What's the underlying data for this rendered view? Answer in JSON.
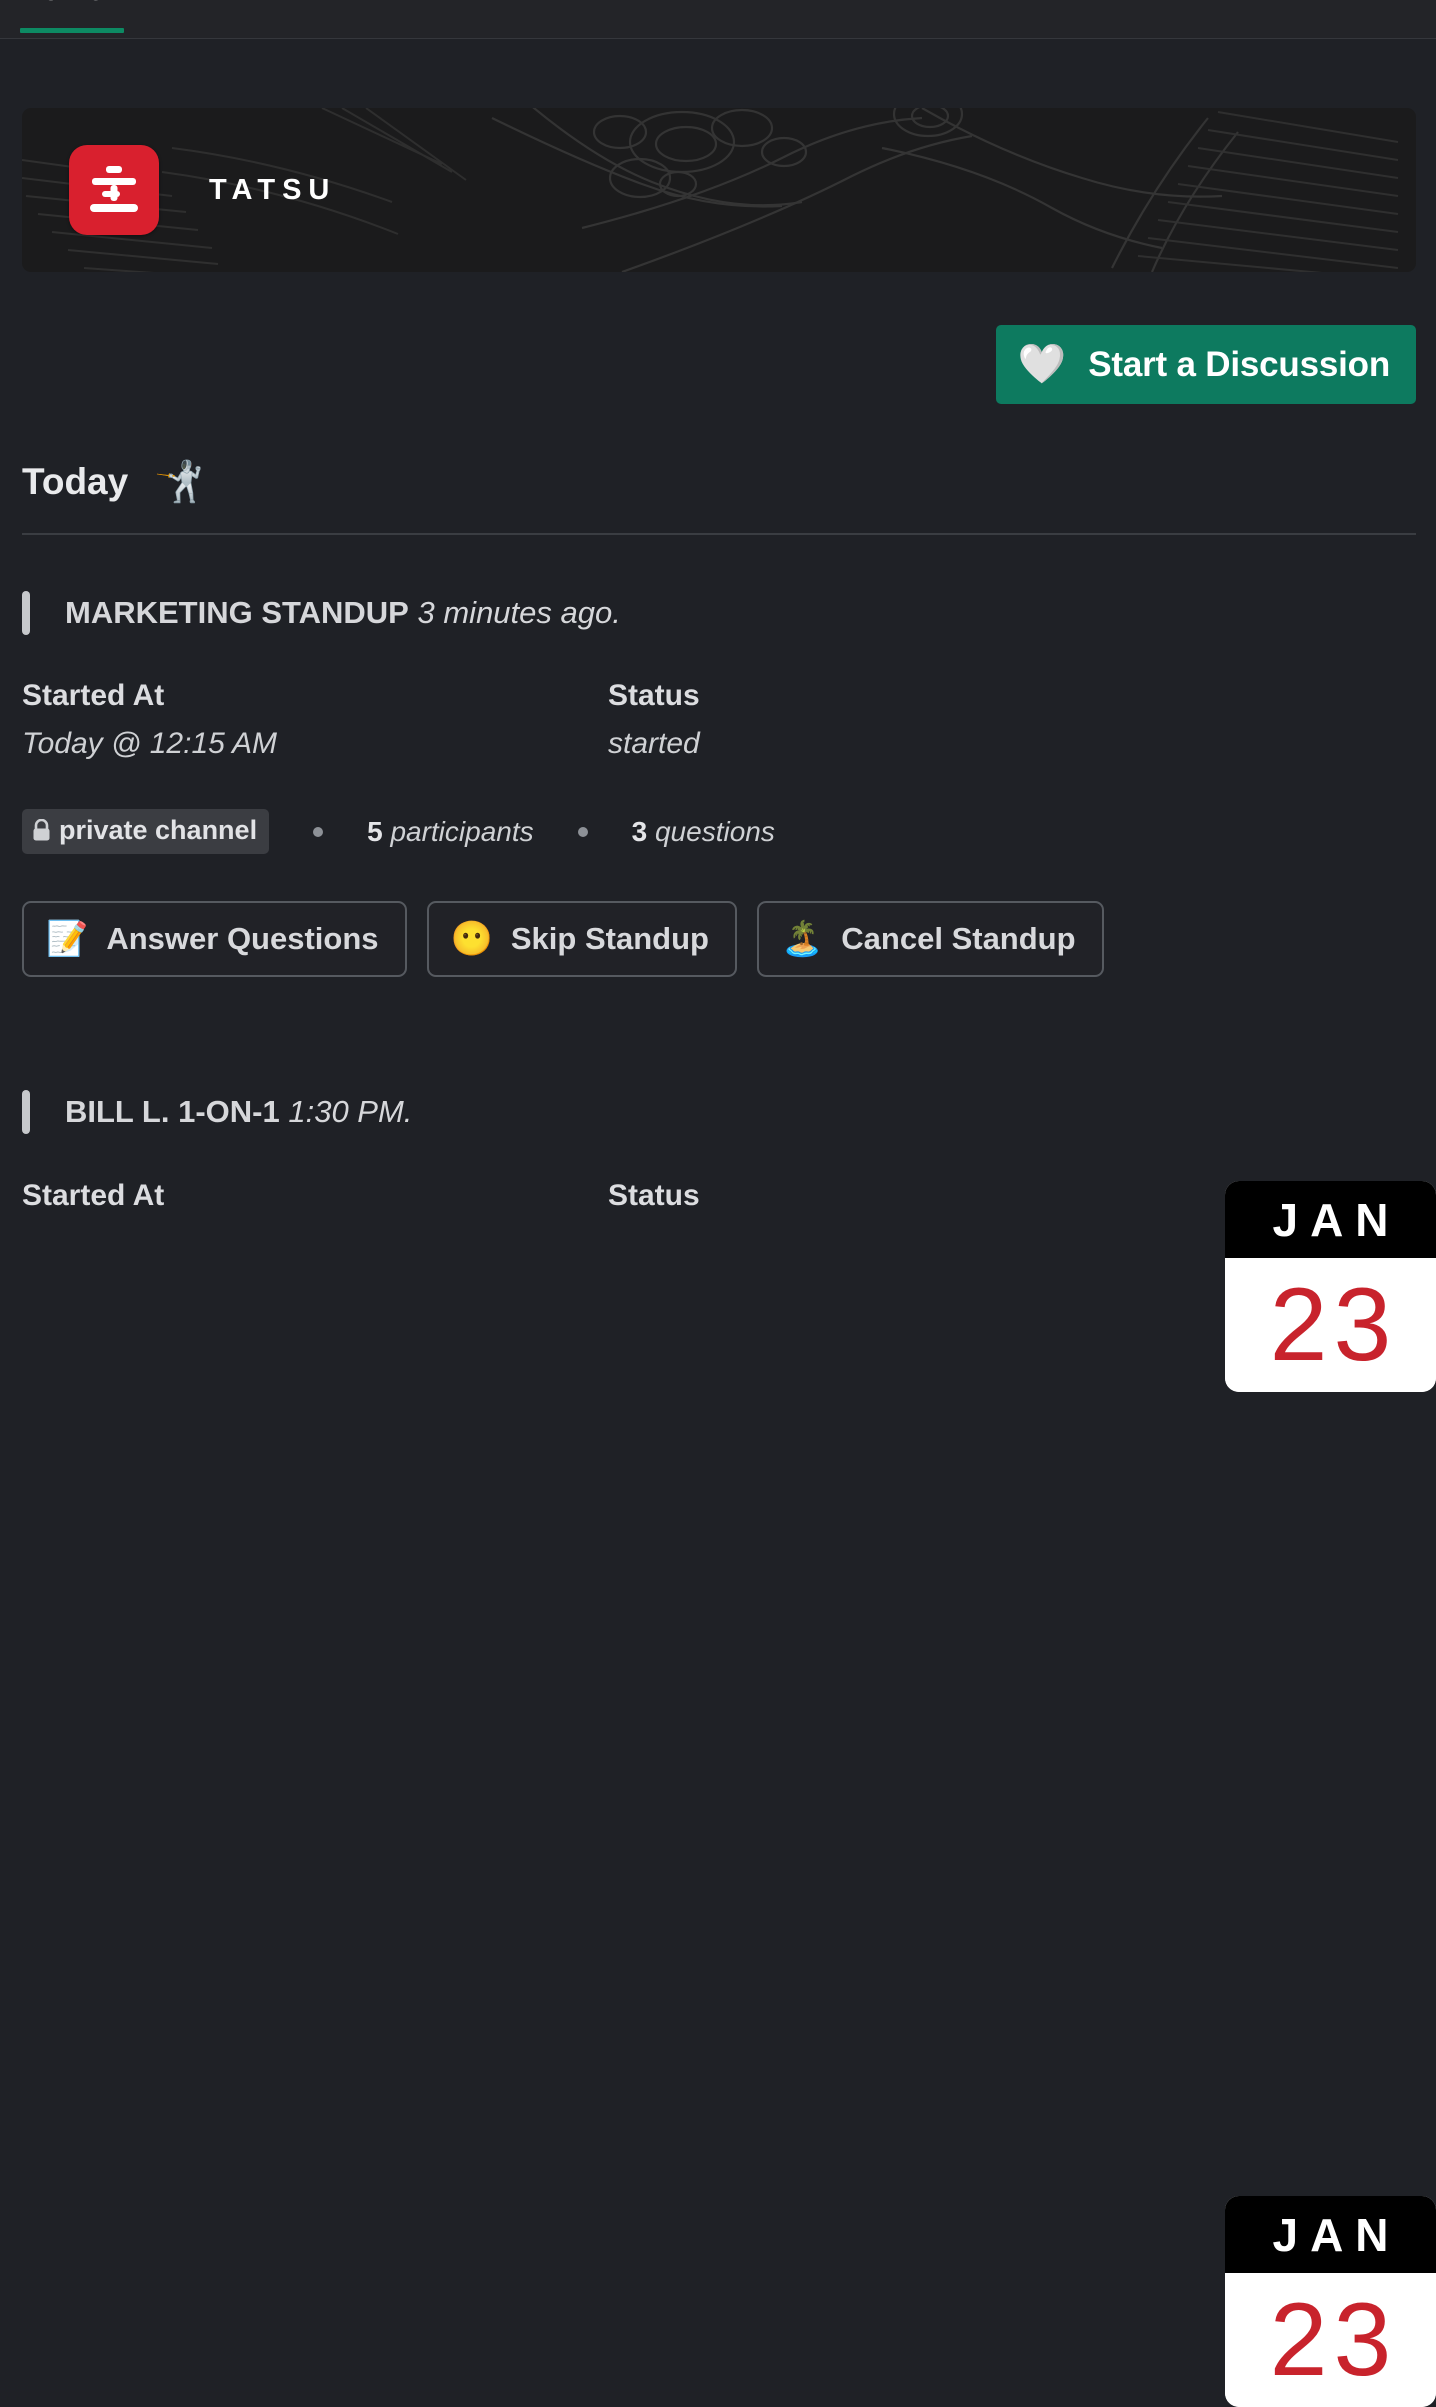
{
  "tabs": {
    "active_label": "Home"
  },
  "banner": {
    "app_name": "TATSU",
    "logo_glyph": "立",
    "logo_bg": "#d9202e",
    "art_name": "dragon-line-art"
  },
  "discussion": {
    "label": "Start a Discussion",
    "emoji": "🤍",
    "bg": "#0d7a5f"
  },
  "section": {
    "label": "Today",
    "emoji": "🤺"
  },
  "entries": [
    {
      "title": "MARKETING STANDUP",
      "time": "3 minutes ago.",
      "started_at_label": "Started At",
      "started_at_value": "Today @ 12:15 AM",
      "status_label": "Status",
      "status_value": "started",
      "channel_badge": "private channel",
      "participants_count": "5",
      "participants_label": "participants",
      "questions_count": "3",
      "questions_label": "questions",
      "actions": [
        {
          "label": "Answer Questions",
          "emoji": "📝"
        },
        {
          "label": "Skip Standup",
          "emoji": "😶"
        },
        {
          "label": "Cancel Standup",
          "emoji": "🏝️"
        }
      ],
      "calendar": {
        "month": "JAN",
        "day": "23"
      }
    },
    {
      "title": "BILL L. 1-ON-1",
      "time": "1:30 PM.",
      "started_at_label": "Started At",
      "status_label": "Status",
      "calendar": {
        "month": "JAN",
        "day": "23"
      }
    }
  ]
}
